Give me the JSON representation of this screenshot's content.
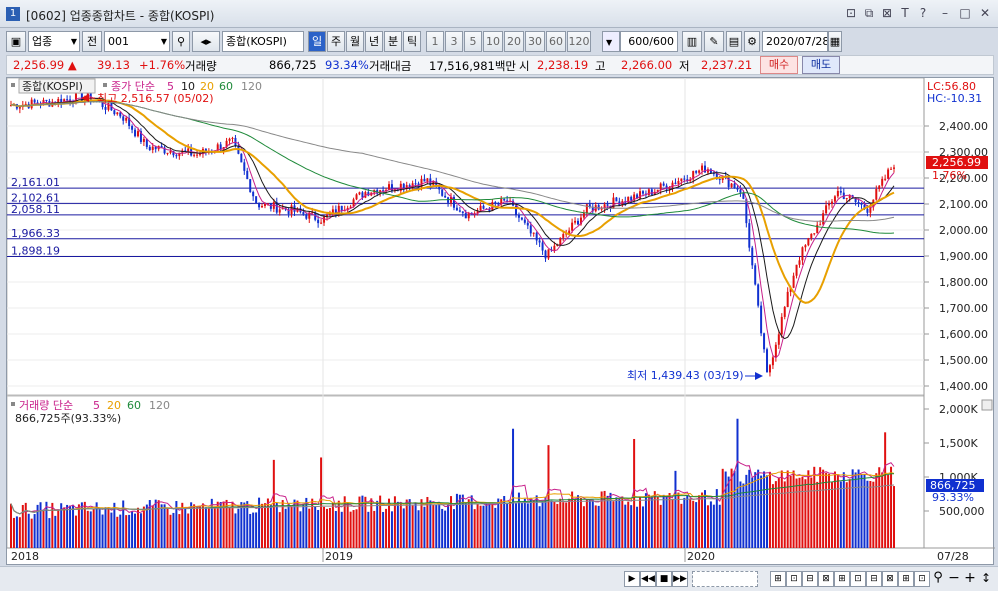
{
  "window": {
    "num": "1",
    "title": "[0602] 업종종합차트 - 종합(KOSPI)"
  },
  "toolbar": {
    "market_select": "업종",
    "prev_label": "전",
    "code_input": "001",
    "code_name": "종합(KOSPI)",
    "periods": [
      "일",
      "주",
      "월",
      "년",
      "분",
      "틱"
    ],
    "active_period": "일",
    "intervals": [
      "1",
      "3",
      "5",
      "10",
      "20",
      "30",
      "60",
      "120"
    ],
    "count_value": "600",
    "count_total": "/600",
    "date": "2020/07/28"
  },
  "quote": {
    "price": "2,256.99 ▲",
    "change": "39.13",
    "change_pct": "+1.76%",
    "volume_label": "거래량",
    "volume": "866,725",
    "volume_pct": "93.34%",
    "amount_label": "거래대금",
    "amount": "17,516,981백만",
    "open_label": "시",
    "open": "2,238.19",
    "high_label": "고",
    "high": "2,266.00",
    "low_label": "저",
    "low": "2,237.21",
    "buy_label": "매수",
    "sell_label": "매도"
  },
  "price_panel": {
    "name": "종합(KOSPI)",
    "ma_legend": {
      "label": "종가 단순",
      "periods": [
        "5",
        "10",
        "20",
        "60",
        "120"
      ]
    },
    "high_note": "최고 2,516.57 (05/02)",
    "low_note": "최저 1,439.43 (03/19)",
    "lc": "LC:56.80",
    "hc": "HC:-10.31",
    "last_price": "2,256.99",
    "last_pct": "1.76%",
    "y_ticks": [
      "2,400.00",
      "2,300.00",
      "2,200.00",
      "2,100.00",
      "2,000.00",
      "1,900.00",
      "1,800.00",
      "1,700.00",
      "1,600.00",
      "1,500.00",
      "1,400.00"
    ],
    "hlines": [
      "2,161.01",
      "2,102.61",
      "2,058.11",
      "1,966.33",
      "1,898.19"
    ]
  },
  "volume_panel": {
    "legend": {
      "label": "거래량 단순",
      "periods": [
        "5",
        "20",
        "60",
        "120"
      ]
    },
    "value_note": "866,725주(93.33%)",
    "y_ticks": [
      "2,000K",
      "1,500K",
      "1,000K",
      "500,000"
    ],
    "last_volume": "866,725",
    "last_pct": "93.33%"
  },
  "x_axis": {
    "labels": [
      "2018",
      "2019",
      "2020"
    ],
    "right_label": "07/28"
  },
  "colors": {
    "up": "#e01010",
    "down": "#1030d0",
    "ma5": "#c8208a",
    "ma10": "#1a1a1a",
    "ma20": "#e8a000",
    "ma60": "#1f8a3a",
    "ma120": "#888888",
    "hline": "#1a1aa0"
  }
}
